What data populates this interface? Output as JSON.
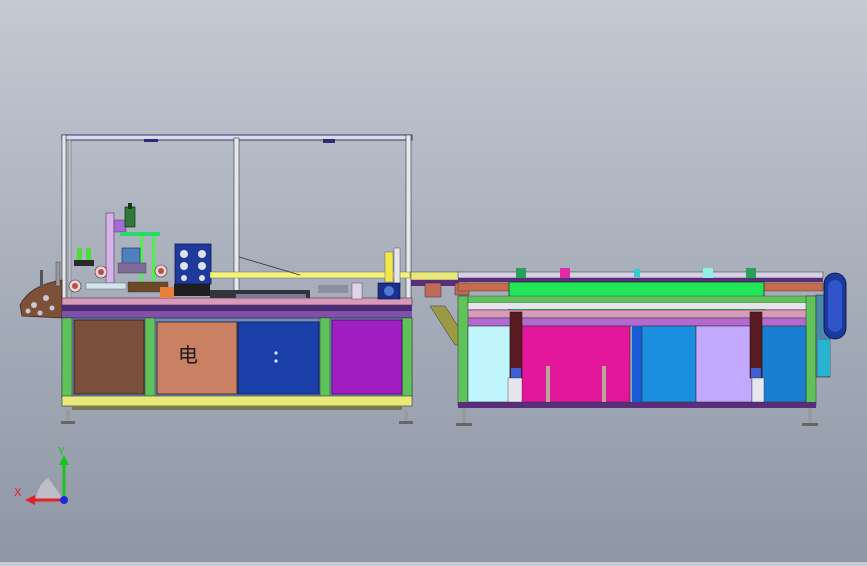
{
  "window": {
    "background": "#a9b0bc"
  },
  "machine": {
    "cabinet_mark": "电",
    "panel_symbol": "⚡"
  },
  "triad": {
    "x_label": "X",
    "y_label": "Y",
    "colors": {
      "x": "#e0202a",
      "y": "#19c619",
      "z": "#1a2ad8"
    }
  },
  "palette": {
    "brown": "#7a4f3c",
    "salmon": "#c98063",
    "royal": "#1b3fa9",
    "purple": "#a11fc2",
    "magenta": "#e2179a",
    "lime": "#22e65a",
    "cyan": "#bff5fb",
    "azure": "#1a8fe0",
    "lavender": "#c3a8ff",
    "frame_green": "#5fc25b",
    "frame_olive": "#9c9a45",
    "rail_pink": "#d89ab9",
    "dark_purple": "#5a2c7c"
  }
}
